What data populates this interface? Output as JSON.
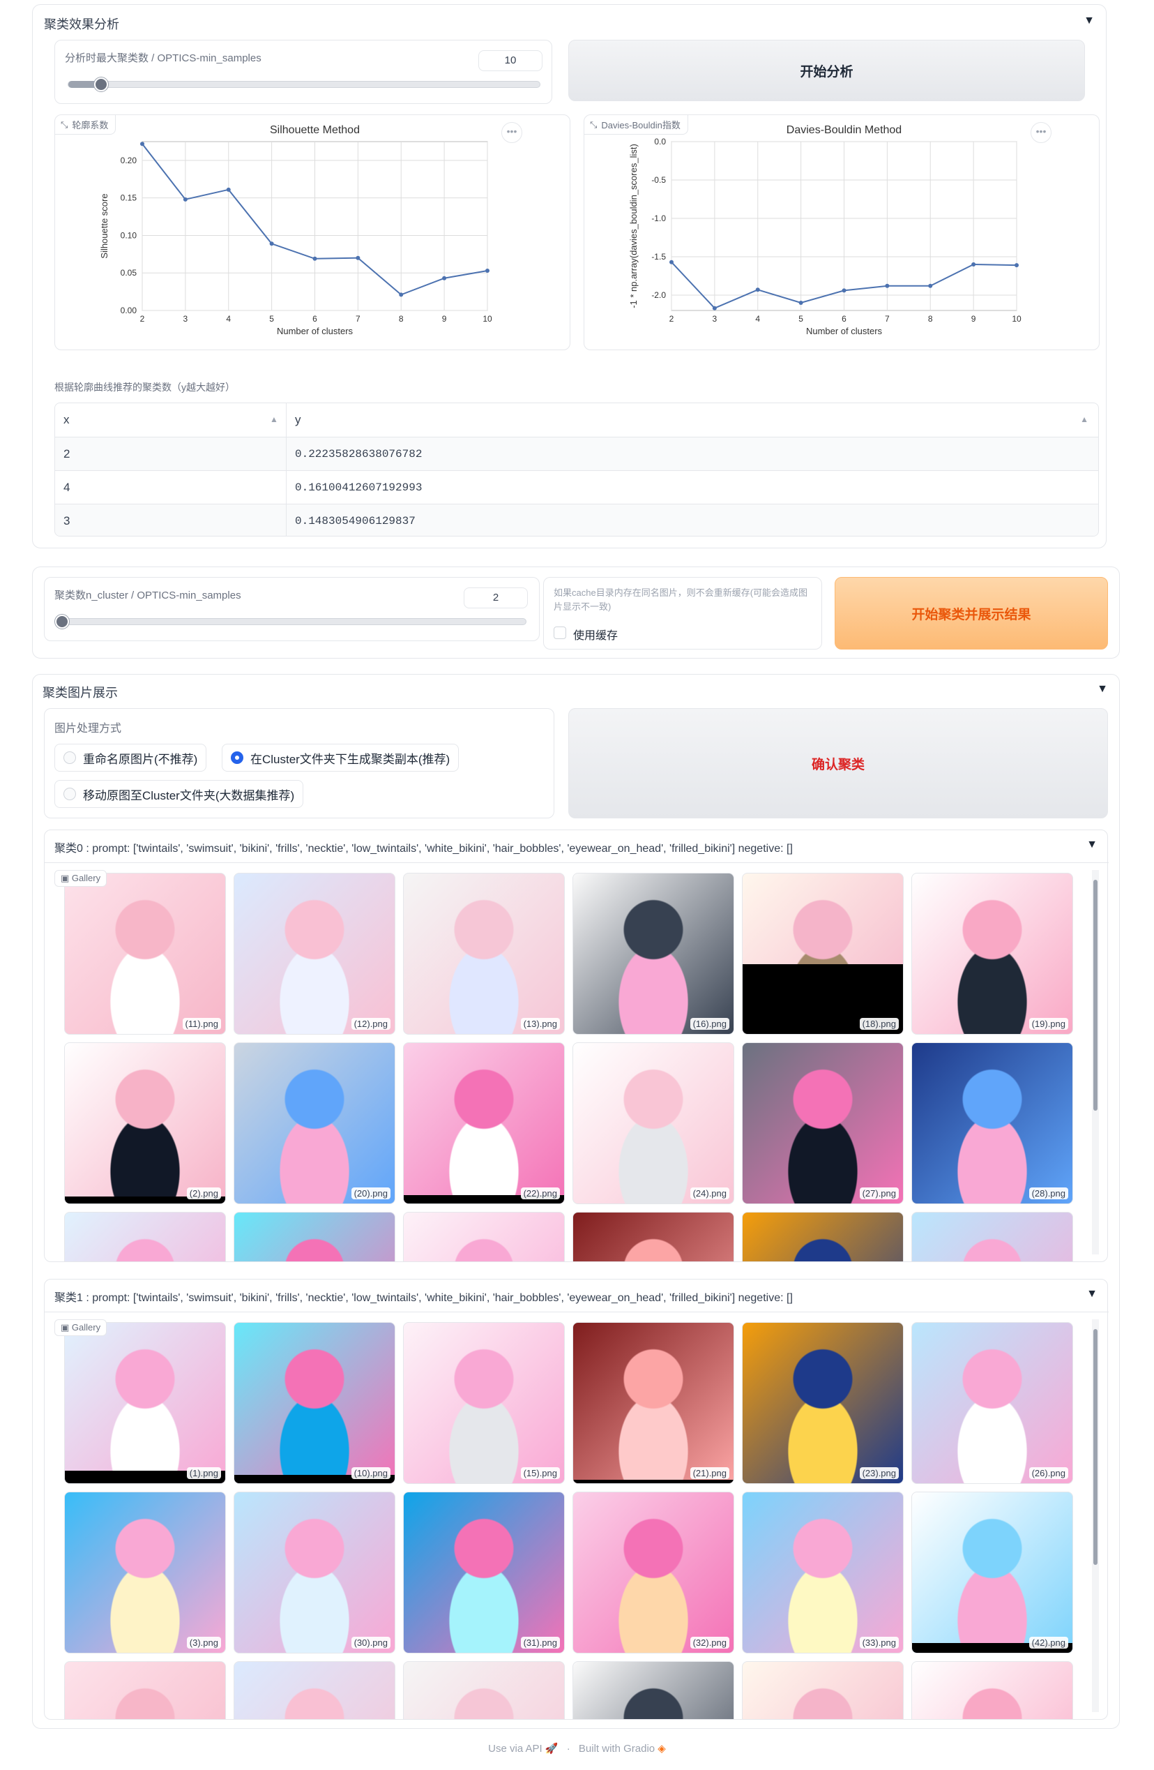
{
  "analysis": {
    "title": "聚类效果分析",
    "slider_label": "分析时最大聚类数 / OPTICS-min_samples",
    "slider_value": "10",
    "slider_fraction": 0.06,
    "start_button": "开始分析",
    "silhouette_chip": "轮廓系数",
    "db_chip": "Davies-Bouldin指数",
    "table_label": "根据轮廓曲线推荐的聚类数（y越大越好）",
    "table_headers": [
      "x",
      "y"
    ],
    "table_rows": [
      [
        "2",
        "0.22235828638076782"
      ],
      [
        "4",
        "0.16100412607192993"
      ],
      [
        "3",
        "0.1483054906129837"
      ]
    ]
  },
  "chart_data": [
    {
      "type": "line",
      "title": "Silhouette Method",
      "xlabel": "Number of clusters",
      "ylabel": "Silhouette score",
      "x": [
        2,
        3,
        4,
        5,
        6,
        7,
        8,
        9,
        10
      ],
      "y": [
        0.222,
        0.148,
        0.161,
        0.089,
        0.069,
        0.07,
        0.021,
        0.043,
        0.053
      ],
      "xlim": [
        2,
        10
      ],
      "ylim": [
        0.0,
        0.225
      ],
      "yticks": [
        "0.00",
        "0.05",
        "0.10",
        "0.15",
        "0.20"
      ],
      "grid": true,
      "color": "#4c72b0"
    },
    {
      "type": "line",
      "title": "Davies-Bouldin Method",
      "xlabel": "Number of clusters",
      "ylabel": "-1 * np.array(davies_bouldin_scores_list)",
      "x": [
        2,
        3,
        4,
        5,
        6,
        7,
        8,
        9,
        10
      ],
      "y": [
        -1.57,
        -2.17,
        -1.93,
        -2.1,
        -1.94,
        -1.88,
        -1.88,
        -1.6,
        -1.61
      ],
      "xlim": [
        2,
        10
      ],
      "ylim": [
        -2.2,
        0.0
      ],
      "yticks": [
        "0.0",
        "-0.5",
        "-1.0",
        "-1.5",
        "-2.0"
      ],
      "grid": true,
      "color": "#4c72b0"
    }
  ],
  "cluster": {
    "slider_label": "聚类数n_cluster / OPTICS-min_samples",
    "slider_value": "2",
    "slider_fraction": 0.0,
    "cache_info": "如果cache目录内存在同名图片，则不会重新缓存(可能会造成图片显示不一致)",
    "cache_checkbox": "使用缓存",
    "start_button": "开始聚类并展示结果"
  },
  "display": {
    "title": "聚类图片展示",
    "method_label": "图片处理方式",
    "options": [
      "重命名原图片(不推荐)",
      "在Cluster文件夹下生成聚类副本(推荐)",
      "移动原图至Cluster文件夹(大数据集推荐)"
    ],
    "selected_index": 1,
    "confirm_button": "确认聚类"
  },
  "clusters": [
    {
      "title": "聚类0 : prompt: ['twintails', 'swimsuit', 'bikini', 'frills', 'necktie', 'low_twintails', 'white_bikini', 'hair_bobbles', 'eyewear_on_head', 'frilled_bikini'] negetive: []",
      "gallery_label": "Gallery",
      "images": [
        "(11).png",
        "(12).png",
        "(13).png",
        "(16).png",
        "(18).png",
        "(19).png",
        "(2).png",
        "(20).png",
        "(22).png",
        "(24).png",
        "(27).png",
        "(28).png"
      ]
    },
    {
      "title": "聚类1 : prompt: ['twintails', 'swimsuit', 'bikini', 'frills', 'necktie', 'low_twintails', 'white_bikini', 'hair_bobbles', 'eyewear_on_head', 'frilled_bikini'] negetive: []",
      "gallery_label": "Gallery",
      "images": [
        "(1).png",
        "(10).png",
        "(15).png",
        "(21).png",
        "(23).png",
        "(26).png",
        "(3).png",
        "(30).png",
        "(31).png",
        "(32).png",
        "(33).png",
        "(42).png"
      ]
    }
  ],
  "footer": {
    "api": "Use via API",
    "sep": "·",
    "built": "Built with Gradio"
  }
}
